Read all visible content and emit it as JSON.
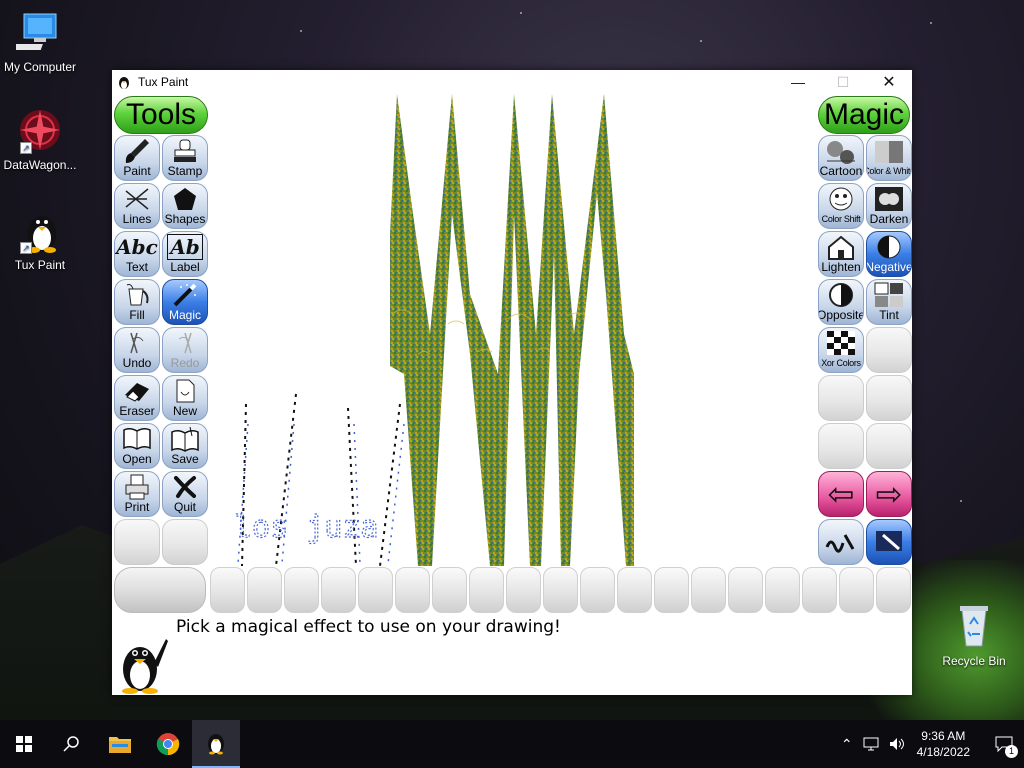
{
  "desktop": {
    "icons": [
      {
        "label": "My Computer",
        "icon": "computer-icon"
      },
      {
        "label": "DataWagon...",
        "icon": "datawagon-icon"
      },
      {
        "label": "Tux Paint",
        "icon": "tux-icon"
      },
      {
        "label": "Recycle Bin",
        "icon": "recycle-bin-icon"
      }
    ]
  },
  "window": {
    "title": "Tux Paint",
    "controls": {
      "minimize": "—",
      "maximize": "☐",
      "close": "✕"
    }
  },
  "tools": {
    "header": "Tools",
    "items": [
      {
        "label": "Paint",
        "icon": "paintbrush-icon",
        "state": "normal"
      },
      {
        "label": "Stamp",
        "icon": "stamp-icon",
        "state": "normal"
      },
      {
        "label": "Lines",
        "icon": "lines-icon",
        "state": "normal"
      },
      {
        "label": "Shapes",
        "icon": "pentagon-icon",
        "state": "normal"
      },
      {
        "label": "Text",
        "icon": "text-abc-icon",
        "state": "normal"
      },
      {
        "label": "Label",
        "icon": "label-ab-icon",
        "state": "normal"
      },
      {
        "label": "Fill",
        "icon": "paint-bucket-icon",
        "state": "normal"
      },
      {
        "label": "Magic",
        "icon": "magic-wand-icon",
        "state": "selected"
      },
      {
        "label": "Undo",
        "icon": "undo-icon",
        "state": "normal"
      },
      {
        "label": "Redo",
        "icon": "redo-icon",
        "state": "disabled"
      },
      {
        "label": "Eraser",
        "icon": "eraser-icon",
        "state": "normal"
      },
      {
        "label": "New",
        "icon": "new-page-icon",
        "state": "normal"
      },
      {
        "label": "Open",
        "icon": "open-book-icon",
        "state": "normal"
      },
      {
        "label": "Save",
        "icon": "save-book-icon",
        "state": "normal"
      },
      {
        "label": "Print",
        "icon": "printer-icon",
        "state": "normal"
      },
      {
        "label": "Quit",
        "icon": "quit-x-icon",
        "state": "normal"
      }
    ],
    "icon_glyphs": {
      "text-abc": "Abc",
      "label-ab": "Ab",
      "quit": "✗",
      "pentagon": "⬟",
      "undo": "↶",
      "redo": "↷"
    }
  },
  "magic": {
    "header": "Magic",
    "items": [
      {
        "label": "Cartoon",
        "icon": "cartoon-icon",
        "state": "normal"
      },
      {
        "label": "Color & White",
        "icon": "color-white-icon",
        "state": "normal"
      },
      {
        "label": "Color Shift",
        "icon": "color-shift-icon",
        "state": "normal"
      },
      {
        "label": "Darken",
        "icon": "darken-icon",
        "state": "normal"
      },
      {
        "label": "Lighten",
        "icon": "lighten-house-icon",
        "state": "normal"
      },
      {
        "label": "Negative",
        "icon": "negative-icon",
        "state": "selected"
      },
      {
        "label": "Opposite",
        "icon": "opposite-icon",
        "state": "normal"
      },
      {
        "label": "Tint",
        "icon": "tint-faces-icon",
        "state": "normal"
      },
      {
        "label": "Xor Colors",
        "icon": "xor-checker-icon",
        "state": "normal"
      }
    ],
    "nav": {
      "prev": "⇦",
      "next": "⇨"
    }
  },
  "status": {
    "message": "Pick a magical effect to use on your drawing!"
  },
  "canvas": {
    "drawn_text": "los juza"
  },
  "taskbar": {
    "apps": [
      {
        "name": "start-button",
        "icon": "windows-logo-icon"
      },
      {
        "name": "search-button",
        "icon": "search-icon"
      },
      {
        "name": "file-explorer-button",
        "icon": "folder-icon"
      },
      {
        "name": "chrome-button",
        "icon": "chrome-icon"
      },
      {
        "name": "tux-paint-taskbar-button",
        "icon": "tux-icon"
      }
    ],
    "clock": {
      "time": "9:36 AM",
      "date": "4/18/2022"
    },
    "notification_count": "1"
  },
  "colors": {
    "tools_header": "#5fd33d",
    "selected": "#3b7fe6",
    "nav_arrow": "#e7569f"
  }
}
